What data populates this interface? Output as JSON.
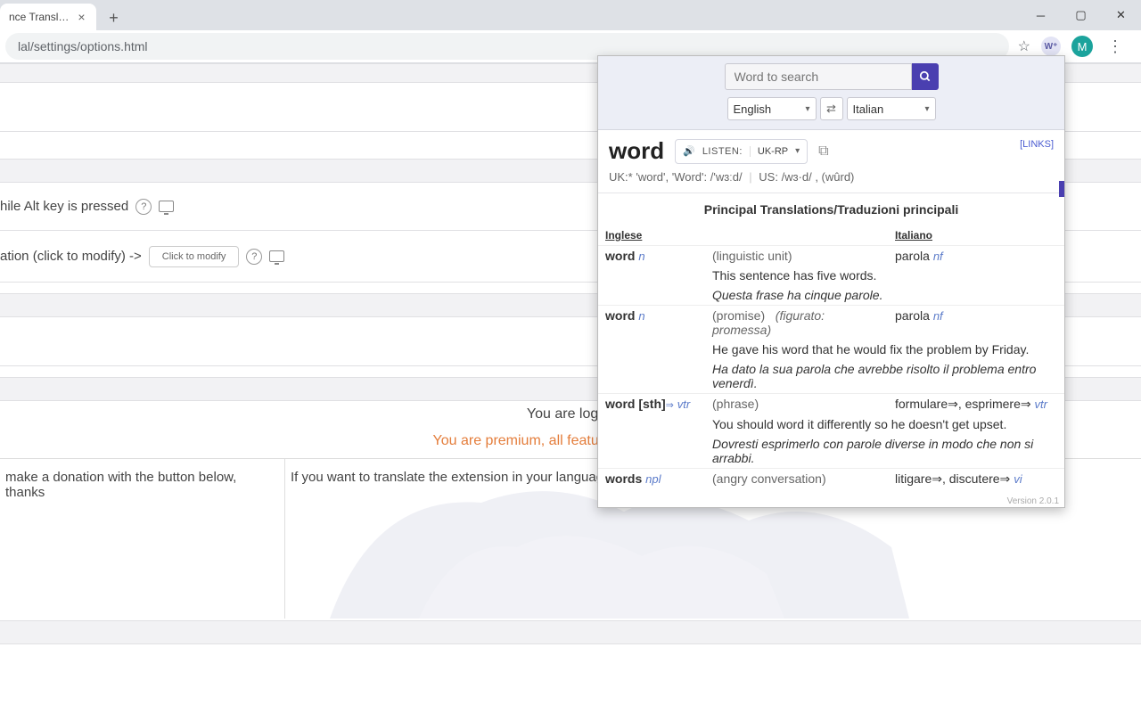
{
  "browser": {
    "tab_title": "nce Transl…",
    "url_fragment": "lal/settings/options.html",
    "avatar_letter": "M"
  },
  "options": {
    "row_alt": "hile Alt key is pressed",
    "row_modify_prefix": "ation (click to modify) ->",
    "modify_btn": "Click to modify",
    "logged_text": "You are logge",
    "premium_text": "You are premium, all features are unlocked!",
    "foot_left": "make a donation with the button below, thanks",
    "foot_right": "If you want to translate the extension in your language you can contact me at the email below"
  },
  "popup": {
    "search_placeholder": "Word to search",
    "lang_from": "English",
    "lang_to": "Italian",
    "title": "word",
    "listen_label": "LISTEN:",
    "accent": "UK-RP",
    "links_label": "[LINKS]",
    "pron_uk_label": "UK:*",
    "pron_uk": "'word', 'Word': /'wɜːd/",
    "pron_us_label": "US:",
    "pron_us": "/wɜ·d/ , (wûrd)",
    "principal_label": "Principal Translations/Traduzioni principali",
    "col1": "Inglese",
    "col2": "Italiano",
    "entries": [
      {
        "src": "word",
        "pos": "n",
        "gloss": "(linguistic unit)",
        "dst": "parola",
        "dstpos": "nf",
        "ex_en": "This sentence has five words.",
        "ex_it": "Questa frase ha cinque parole."
      },
      {
        "src": "word",
        "pos": "n",
        "gloss": "(promise)",
        "gloss2": "(figurato: promessa)",
        "dst": "parola",
        "dstpos": "nf",
        "ex_en": "He gave his word that he would fix the problem by Friday.",
        "ex_it": "Ha dato la sua parola che avrebbe risolto il problema entro venerdì."
      },
      {
        "src": "word [sth]",
        "pos": "vtr",
        "srcarrow": true,
        "gloss": "(phrase)",
        "dst": "formulare⇒, esprimere⇒",
        "dstpos": "vtr",
        "ex_en": "You should word it differently so he doesn't get upset.",
        "ex_it": "Dovresti esprimerlo con parole diverse in modo che non si arrabbi."
      },
      {
        "src": "words",
        "pos": "npl",
        "gloss": "(angry conversation)",
        "dst": "litigare⇒, discutere⇒",
        "dstpos": "vi"
      }
    ],
    "version": "Version 2.0.1"
  }
}
